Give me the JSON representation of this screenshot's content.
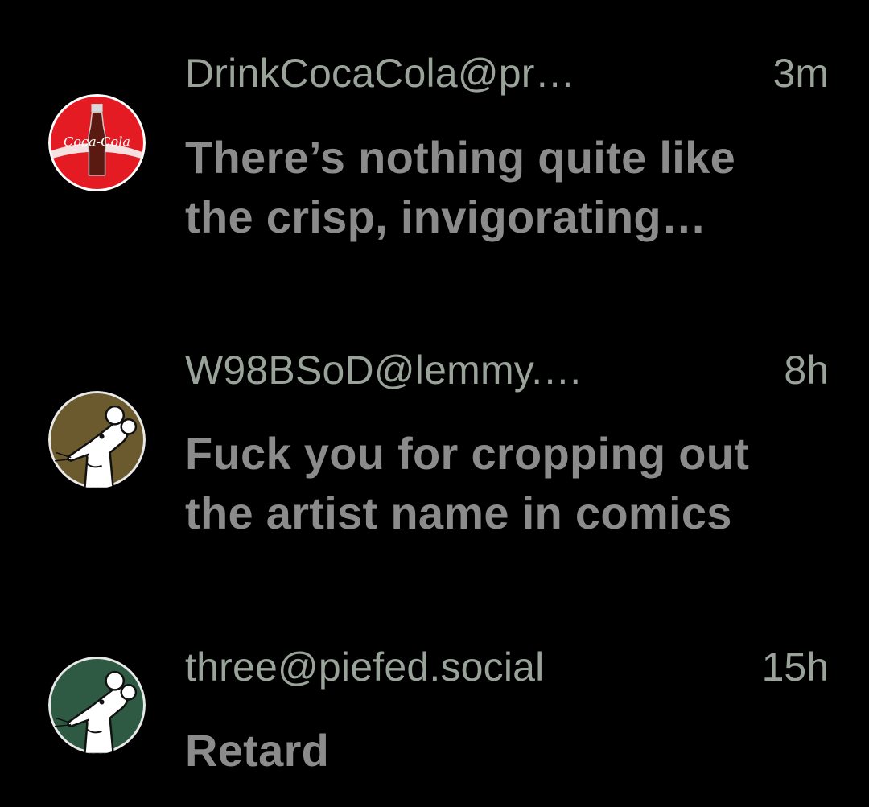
{
  "comments": [
    {
      "handle": "DrinkCocaCola@pr…",
      "time": "3m",
      "body_line1": "There’s nothing quite like",
      "body_line2": "the crisp, invigorating…",
      "avatar": {
        "icon": "coca-cola-avatar-icon",
        "color": "#e41b23"
      }
    },
    {
      "handle": "W98BSoD@lemmy.…",
      "time": "8h",
      "body_line1": "Fuck you for cropping out",
      "body_line2": "the artist name in comics",
      "avatar": {
        "icon": "rat-avatar-icon",
        "color": "#6b5a2e"
      }
    },
    {
      "handle": "three@piefed.social",
      "time": "15h",
      "body_line1": "Retard",
      "body_line2": "",
      "avatar": {
        "icon": "rat-avatar-icon",
        "color": "#2e5a44"
      }
    }
  ],
  "colors": {
    "background": "#000000",
    "handle": "#9aa39a",
    "body": "#8b8b8b"
  }
}
